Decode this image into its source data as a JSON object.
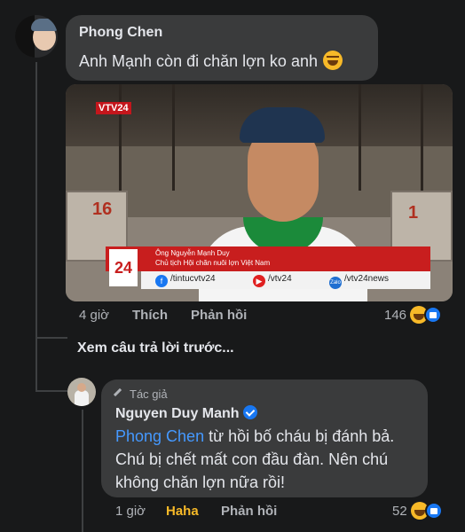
{
  "comment1": {
    "author": "Phong Chen",
    "text": "Anh Mạnh còn đi chăn lợn ko anh",
    "emoji_icon": "rofl-emoji",
    "media": {
      "channel_logo": "VTV24",
      "pen_label_left": "16",
      "pen_label_right": "1",
      "caption_name": "Ông Nguyễn Mạnh Duy",
      "caption_role": "Chủ tịch Hội chăn nuôi lợn Việt Nam",
      "caption_badge": "24",
      "social_facebook": "/tintucvtv24",
      "social_youtube": "/vtv24",
      "social_zalo": "/vtv24news"
    },
    "time": "4 giờ",
    "like_label": "Thích",
    "reply_label": "Phản hồi",
    "reaction_count": "146"
  },
  "view_previous": "Xem câu trả lời trước...",
  "reply": {
    "badge": "Tác giả",
    "author": "Nguyen Duy Manh",
    "mention": "Phong Chen",
    "line1_rest": " từ hồi bố cháu bị đánh bả.",
    "line2": "Chú bị chết mất con đầu đàn. Nên chú",
    "line3": "không chăn lợn nữa rồi!",
    "time": "1 giờ",
    "reaction_label": "Haha",
    "reply_label": "Phản hồi",
    "reaction_count": "52"
  },
  "colors": {
    "background": "#18191a",
    "bubble": "#3a3b3c",
    "mention": "#4599ff",
    "haha": "#f7b928",
    "like": "#1877f2"
  }
}
